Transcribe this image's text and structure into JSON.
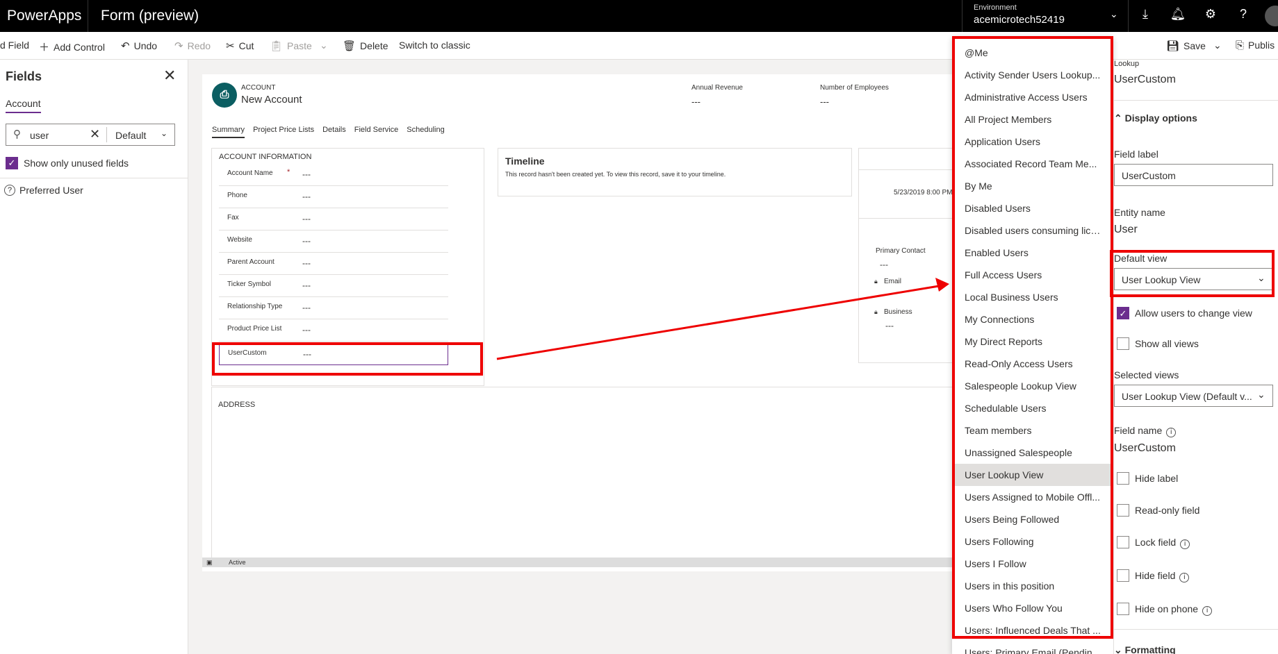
{
  "app": {
    "name": "PowerApps",
    "form_title": "Form (preview)"
  },
  "environment": {
    "label": "Environment",
    "name": "acemicrotech52419"
  },
  "toolbar": {
    "add_field": "d Field",
    "add_control": "Add Control",
    "undo": "Undo",
    "redo": "Redo",
    "cut": "Cut",
    "paste": "Paste",
    "delete": "Delete",
    "switch": "Switch to classic",
    "save": "Save",
    "publish": "Publis"
  },
  "fields_panel": {
    "title": "Fields",
    "tab": "Account",
    "search_value": "user",
    "filter": "Default",
    "show_unused": "Show only unused fields",
    "items": [
      "Preferred User"
    ]
  },
  "form": {
    "entity": "ACCOUNT",
    "record_name": "New Account",
    "header_fields": [
      {
        "label": "Annual Revenue",
        "value": "---"
      },
      {
        "label": "Number of Employees",
        "value": "---"
      }
    ],
    "tabs": [
      "Summary",
      "Project Price Lists",
      "Details",
      "Field Service",
      "Scheduling"
    ],
    "section_title": "ACCOUNT INFORMATION",
    "fields": [
      {
        "label": "Account Name",
        "value": "---",
        "required": "*"
      },
      {
        "label": "Phone",
        "value": "---"
      },
      {
        "label": "Fax",
        "value": "---"
      },
      {
        "label": "Website",
        "value": "---"
      },
      {
        "label": "Parent Account",
        "value": "---"
      },
      {
        "label": "Ticker Symbol",
        "value": "---"
      },
      {
        "label": "Relationship Type",
        "value": "---"
      },
      {
        "label": "Product Price List",
        "value": "---"
      },
      {
        "label": "UserCustom",
        "value": "---"
      }
    ],
    "timeline_title": "Timeline",
    "timeline_text": "This record hasn't been created yet.  To view this record, save it to your timeline.",
    "date_text": "5/23/2019 8:00 PM",
    "primary_contact": "Primary Contact",
    "primary_contact_value": "---",
    "email_label": "Email",
    "business_label": "Business",
    "business_value": "---",
    "address_title": "ADDRESS",
    "status": "Active"
  },
  "view_list": {
    "items": [
      "@Me",
      "Activity Sender Users Lookup...",
      "Administrative Access Users",
      "All Project Members",
      "Application Users",
      "Associated Record Team Me...",
      "By Me",
      "Disabled Users",
      "Disabled users consuming lice...",
      "Enabled Users",
      "Full Access Users",
      "Local Business Users",
      "My Connections",
      "My Direct Reports",
      "Read-Only Access Users",
      "Salespeople Lookup View",
      "Schedulable Users",
      "Team members",
      "Unassigned Salespeople",
      "User Lookup View",
      "Users Assigned to Mobile Offl...",
      "Users Being Followed",
      "Users Following",
      "Users I Follow",
      "Users in this position",
      "Users Who Follow You",
      "Users: Influenced Deals That ...",
      "Users: Primary Email (Pending..."
    ],
    "selected": "User Lookup View"
  },
  "properties": {
    "type": "Lookup",
    "name": "UserCustom",
    "display_options": "Display options",
    "field_label_label": "Field label",
    "field_label_value": "UserCustom",
    "entity_name_label": "Entity name",
    "entity_name_value": "User",
    "default_view_label": "Default view",
    "default_view_value": "User Lookup View",
    "allow_change": "Allow users to change view",
    "show_all": "Show all views",
    "selected_views_label": "Selected views",
    "selected_views_value": "User Lookup View (Default v...",
    "field_name_label": "Field name",
    "field_name_value": "UserCustom",
    "hide_label": "Hide label",
    "read_only": "Read-only field",
    "lock_field": "Lock field",
    "hide_field": "Hide field",
    "hide_phone": "Hide on phone",
    "formatting": "Formatting"
  },
  "colors": {
    "accent": "#6b2d8e",
    "annotation": "#e00000",
    "header": "#000000"
  }
}
